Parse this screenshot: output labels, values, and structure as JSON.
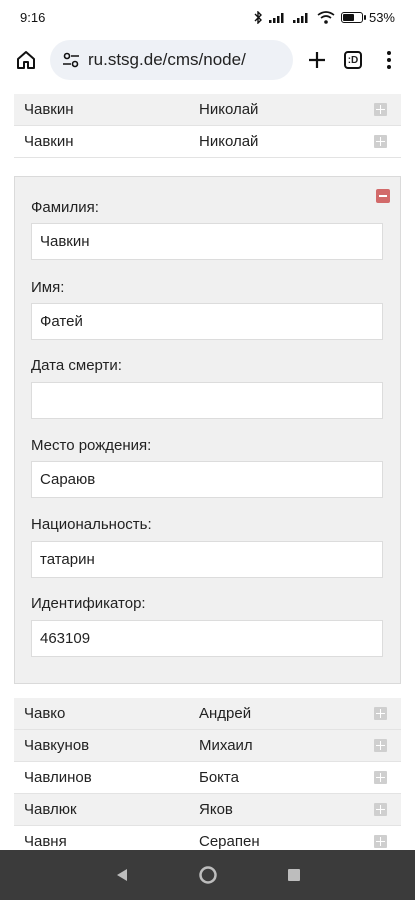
{
  "status_bar": {
    "time": "9:16",
    "battery": "53%",
    "battery_level": 0.53
  },
  "browser": {
    "url": "ru.stsg.de/cms/node/",
    "tabs_label": ":D"
  },
  "top_rows": [
    {
      "last": "Чавкин",
      "first": "Николай"
    },
    {
      "last": "Чавкин",
      "first": "Николай"
    }
  ],
  "form": {
    "fields": [
      {
        "label": "Фамилия:",
        "value": "Чавкин"
      },
      {
        "label": "Имя:",
        "value": "Фатей"
      },
      {
        "label": "Дата смерти:",
        "value": ""
      },
      {
        "label": "Место рождения:",
        "value": "Сараюв"
      },
      {
        "label": "Национальность:",
        "value": "татарин"
      },
      {
        "label": "Идентификатор:",
        "value": "463109"
      }
    ]
  },
  "bottom_rows": [
    {
      "last": "Чавко",
      "first": "Андрей"
    },
    {
      "last": "Чавкунов",
      "first": "Михаил"
    },
    {
      "last": "Чавлинов",
      "first": "Бокта"
    },
    {
      "last": "Чавлюк",
      "first": "Яков"
    },
    {
      "last": "Чавня",
      "first": "Серапен"
    }
  ]
}
